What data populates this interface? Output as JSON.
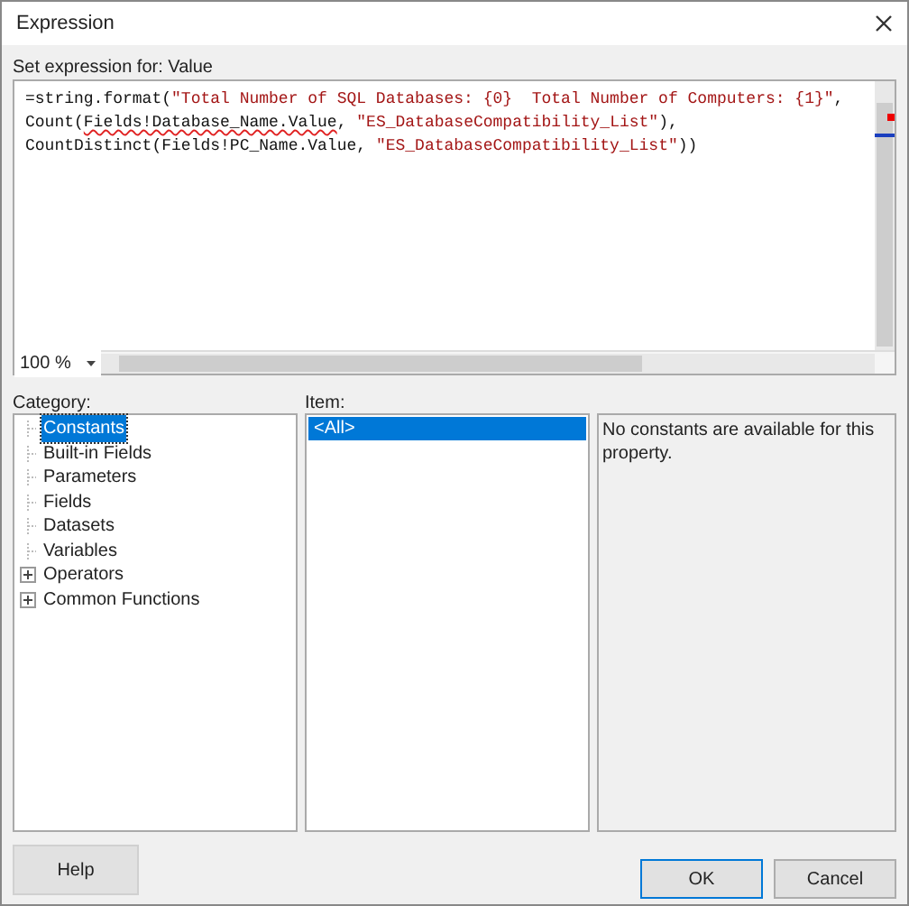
{
  "window": {
    "title": "Expression"
  },
  "expression_label": "Set expression for: Value",
  "editor": {
    "lines": [
      [
        {
          "kind": "code",
          "text": "=string.format("
        },
        {
          "kind": "string",
          "text": "\"Total Number of SQL Databases: {0}  Total Number of Computers: {1}\""
        },
        {
          "kind": "code",
          "text": ","
        }
      ],
      [
        {
          "kind": "code",
          "text": "Count("
        },
        {
          "kind": "error",
          "text": "Fields!Database_Name.Value"
        },
        {
          "kind": "code",
          "text": ", "
        },
        {
          "kind": "string",
          "text": "\"ES_DatabaseCompatibility_List\""
        },
        {
          "kind": "code",
          "text": "),"
        }
      ],
      [
        {
          "kind": "code",
          "text": "CountDistinct(Fields!PC_Name.Value, "
        },
        {
          "kind": "string",
          "text": "\"ES_DatabaseCompatibility_List\""
        },
        {
          "kind": "code",
          "text": "))"
        }
      ]
    ],
    "zoom": "100 %"
  },
  "category": {
    "label": "Category:",
    "items": [
      {
        "label": "Constants",
        "selected": true,
        "expandable": false
      },
      {
        "label": "Built-in Fields",
        "selected": false,
        "expandable": false
      },
      {
        "label": "Parameters",
        "selected": false,
        "expandable": false
      },
      {
        "label": "Fields",
        "selected": false,
        "expandable": false
      },
      {
        "label": "Datasets",
        "selected": false,
        "expandable": false
      },
      {
        "label": "Variables",
        "selected": false,
        "expandable": false
      },
      {
        "label": "Operators",
        "selected": false,
        "expandable": true
      },
      {
        "label": "Common Functions",
        "selected": false,
        "expandable": true
      }
    ]
  },
  "item": {
    "label": "Item:",
    "items": [
      {
        "label": "<All>",
        "selected": true
      }
    ]
  },
  "description": "No constants are available for this property.",
  "buttons": {
    "help": "Help",
    "ok": "OK",
    "cancel": "Cancel"
  }
}
